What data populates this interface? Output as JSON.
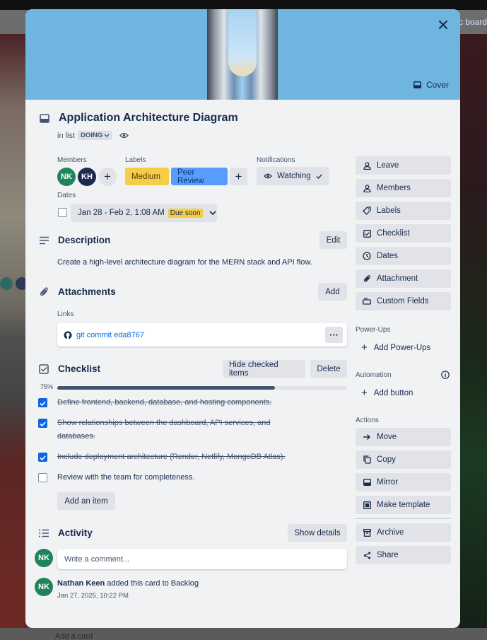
{
  "backdrop": {
    "board_text": "c board",
    "add_card": "Add a card"
  },
  "cover": {
    "button_label": "Cover"
  },
  "card": {
    "title": "Application Architecture Diagram",
    "in_list_prefix": "in list",
    "list_name": "DOING"
  },
  "members": {
    "label": "Members",
    "avatars": [
      {
        "initials": "NK",
        "color": "#1f845a"
      },
      {
        "initials": "KH",
        "color": "#1d2b4f"
      }
    ]
  },
  "labels": {
    "label": "Labels",
    "items": [
      {
        "name": "Medium",
        "color": "#f5cd47"
      },
      {
        "name": "Peer Review",
        "color": "#579dff"
      }
    ]
  },
  "notifications": {
    "label": "Notifications",
    "button": "Watching"
  },
  "dates": {
    "label": "Dates",
    "range": "Jan 28 - Feb 2, 1:08 AM",
    "badge": "Due soon"
  },
  "description": {
    "title": "Description",
    "edit_label": "Edit",
    "text": "Create a high-level architecture diagram for the MERN stack and API flow."
  },
  "attachments": {
    "title": "Attachments",
    "add_label": "Add",
    "links_label": "Links",
    "link_text": "git commit eda8767"
  },
  "checklist": {
    "title": "Checklist",
    "hide_label": "Hide checked items",
    "delete_label": "Delete",
    "progress_text": "75%",
    "progress": 0.75,
    "items": [
      {
        "text": "Define frontend, backend, database, and hosting components.",
        "checked": true
      },
      {
        "text_line1": "Show relationships between the dashboard, API services, and",
        "text_line2": "databases.",
        "checked": true
      },
      {
        "text": "Include deployment architecture (Render, Netlify, MongoDB Atlas).",
        "checked": true
      },
      {
        "text": "Review with the team for completeness.",
        "checked": false
      }
    ],
    "add_item_label": "Add an item"
  },
  "activity": {
    "title": "Activity",
    "show_details_label": "Show details",
    "comment_placeholder": "Write a comment...",
    "user_initials": "NK",
    "entry_user": "Nathan Keen",
    "entry_action": " added this card to Backlog",
    "entry_time": "Jan 27, 2025, 10:22 PM"
  },
  "sidebar": {
    "card_actions": [
      "Leave",
      "Members",
      "Labels",
      "Checklist",
      "Dates",
      "Attachment",
      "Custom Fields"
    ],
    "powerups_label": "Power-Ups",
    "add_powerups": "Add Power-Ups",
    "automation_label": "Automation",
    "add_button": "Add button",
    "actions_label": "Actions",
    "actions": [
      "Move",
      "Copy",
      "Mirror",
      "Make template"
    ],
    "archive": "Archive",
    "share": "Share"
  }
}
